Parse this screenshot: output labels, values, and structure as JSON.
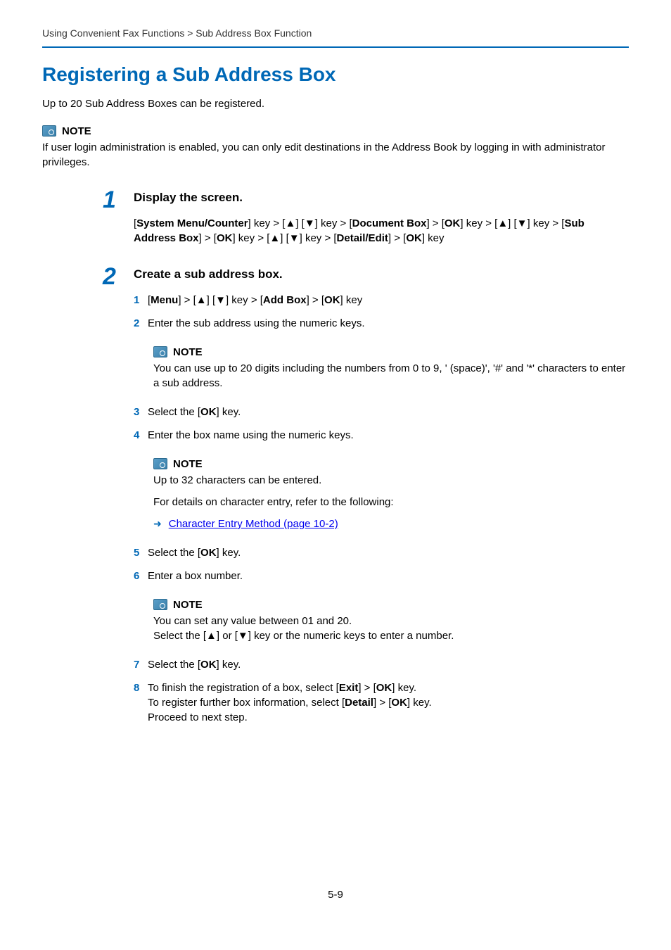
{
  "breadcrumb": "Using Convenient Fax Functions > Sub Address Box Function",
  "title": "Registering a Sub Address Box",
  "intro": "Up to 20 Sub Address Boxes can be registered.",
  "topNote": {
    "label": "NOTE",
    "body": "If user login administration is enabled, you can only edit destinations in the Address Book by logging in with administrator privileges."
  },
  "step1": {
    "num": "1",
    "heading": "Display the screen.",
    "keys": {
      "sysMenu": "System Menu/Counter",
      "docBox": "Document Box",
      "ok": "OK",
      "subBox": "Sub Address Box",
      "detailEdit": "Detail/Edit"
    }
  },
  "step2": {
    "num": "2",
    "heading": "Create a sub address box.",
    "s1": {
      "menu": "Menu",
      "addBox": "Add Box",
      "ok": "OK"
    },
    "s2": "Enter the sub address using the numeric keys.",
    "note2": {
      "label": "NOTE",
      "body": "You can use up to 20 digits including the numbers from 0 to 9, ' (space)', '#' and '*' characters to enter a sub address."
    },
    "s3": {
      "pre": "Select the [",
      "ok": "OK",
      "post": "] key."
    },
    "s4": "Enter the box name using the numeric keys.",
    "note4": {
      "label": "NOTE",
      "line1": "Up to 32 characters can be entered.",
      "line2": "For details on character entry, refer to the following:",
      "link": "Character Entry Method (page 10-2)"
    },
    "s5": {
      "pre": "Select the [",
      "ok": "OK",
      "post": "] key."
    },
    "s6": "Enter a box number.",
    "note6": {
      "label": "NOTE",
      "line1": "You can set any value between 01 and 20.",
      "line2": "Select the [▲] or [▼] key or the numeric keys to enter a number."
    },
    "s7": {
      "pre": "Select the [",
      "ok": "OK",
      "post": "] key."
    },
    "s8": {
      "l1a": "To finish the registration of a box, select [",
      "exit": "Exit",
      "l1b": "] > [",
      "ok": "OK",
      "l1c": "] key.",
      "l2a": "To register further box information, select [",
      "detail": "Detail",
      "l2b": "] > [",
      "l2c": "] key.",
      "l3": "Proceed to next step."
    }
  },
  "nums": {
    "n1": "1",
    "n2": "2",
    "n3": "3",
    "n4": "4",
    "n5": "5",
    "n6": "6",
    "n7": "7",
    "n8": "8"
  },
  "pageNum": "5-9"
}
